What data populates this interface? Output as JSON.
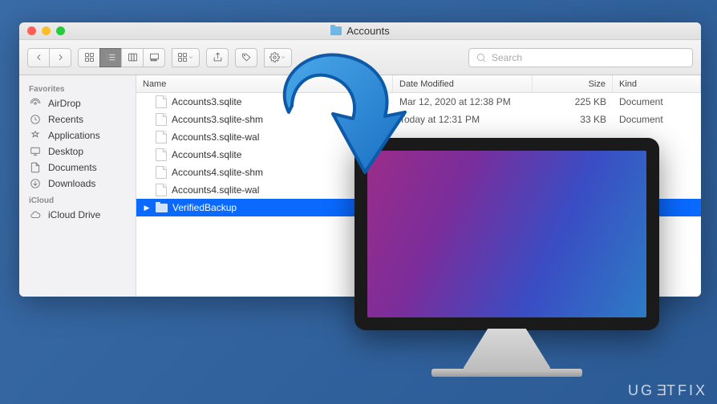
{
  "window": {
    "title": "Accounts"
  },
  "toolbar": {
    "search_placeholder": "Search"
  },
  "sidebar": {
    "sections": [
      {
        "heading": "Favorites",
        "items": [
          {
            "label": "AirDrop",
            "icon": "airdrop-icon"
          },
          {
            "label": "Recents",
            "icon": "recents-icon"
          },
          {
            "label": "Applications",
            "icon": "applications-icon"
          },
          {
            "label": "Desktop",
            "icon": "desktop-icon"
          },
          {
            "label": "Documents",
            "icon": "documents-icon"
          },
          {
            "label": "Downloads",
            "icon": "downloads-icon"
          }
        ]
      },
      {
        "heading": "iCloud",
        "items": [
          {
            "label": "iCloud Drive",
            "icon": "icloud-icon"
          }
        ]
      }
    ]
  },
  "columns": {
    "name": "Name",
    "date": "Date Modified",
    "size": "Size",
    "kind": "Kind"
  },
  "rows": [
    {
      "name": "Accounts3.sqlite",
      "type": "file",
      "date": "Mar 12, 2020 at 12:38 PM",
      "size": "225 KB",
      "kind": "Document",
      "selected": false
    },
    {
      "name": "Accounts3.sqlite-shm",
      "type": "file",
      "date": "Today at 12:31 PM",
      "size": "33 KB",
      "kind": "Document",
      "selected": false
    },
    {
      "name": "Accounts3.sqlite-wal",
      "type": "file",
      "date": "",
      "size": "",
      "kind": "",
      "selected": false
    },
    {
      "name": "Accounts4.sqlite",
      "type": "file",
      "date": "",
      "size": "",
      "kind": "",
      "selected": false
    },
    {
      "name": "Accounts4.sqlite-shm",
      "type": "file",
      "date": "",
      "size": "",
      "kind": "",
      "selected": false
    },
    {
      "name": "Accounts4.sqlite-wal",
      "type": "file",
      "date": "",
      "size": "",
      "kind": "",
      "selected": false
    },
    {
      "name": "VerifiedBackup",
      "type": "folder",
      "date": "",
      "size": "",
      "kind": "",
      "selected": true
    }
  ],
  "watermark": "UGETFIX"
}
